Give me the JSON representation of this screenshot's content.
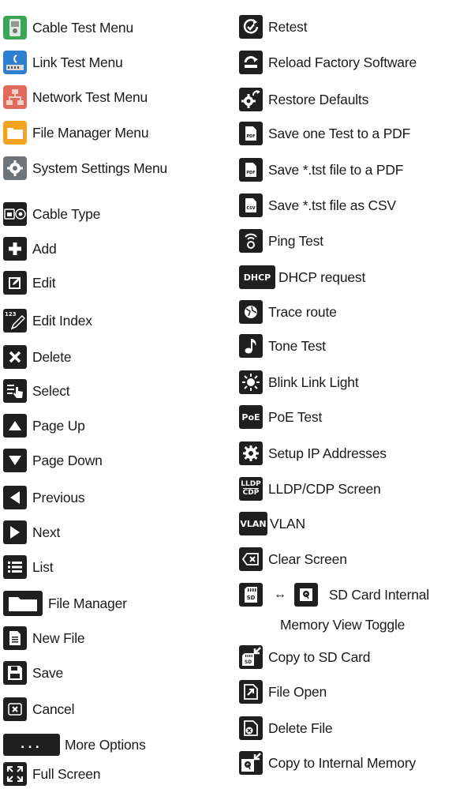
{
  "colors": {
    "icon_bg": "#1f1f1f",
    "cable_test": "#3aa655",
    "link_test": "#2f7fd0",
    "network_test": "#e26a5c",
    "file_manager": "#f5a31f",
    "system_settings": "#6f7478"
  },
  "left": [
    {
      "icon": "cable-test-menu-icon",
      "label": "Cable Test Menu"
    },
    {
      "icon": "link-test-menu-icon",
      "label": "Link Test Menu"
    },
    {
      "icon": "network-test-menu-icon",
      "label": "Network Test Menu"
    },
    {
      "icon": "file-manager-menu-icon",
      "label": "File Manager Menu"
    },
    {
      "icon": "system-settings-menu-icon",
      "label": "System Settings Menu"
    },
    {
      "icon": "cable-type-icon",
      "label": "Cable Type"
    },
    {
      "icon": "add-icon",
      "label": "Add"
    },
    {
      "icon": "edit-icon",
      "label": "Edit"
    },
    {
      "icon": "edit-index-icon",
      "label": "Edit Index",
      "icon_text": "123"
    },
    {
      "icon": "delete-icon",
      "label": "Delete"
    },
    {
      "icon": "select-icon",
      "label": "Select"
    },
    {
      "icon": "page-up-icon",
      "label": "Page Up"
    },
    {
      "icon": "page-down-icon",
      "label": "Page Down"
    },
    {
      "icon": "previous-icon",
      "label": "Previous"
    },
    {
      "icon": "next-icon",
      "label": "Next"
    },
    {
      "icon": "list-icon",
      "label": "List"
    },
    {
      "icon": "file-manager-icon",
      "label": "File Manager"
    },
    {
      "icon": "new-file-icon",
      "label": "New File"
    },
    {
      "icon": "save-icon",
      "label": "Save"
    },
    {
      "icon": "cancel-icon",
      "label": "Cancel"
    },
    {
      "icon": "more-options-icon",
      "label": "More Options",
      "icon_text": "..."
    },
    {
      "icon": "full-screen-icon",
      "label": "Full Screen"
    }
  ],
  "right": [
    {
      "icon": "retest-icon",
      "label": "Retest"
    },
    {
      "icon": "reload-factory-software-icon",
      "label": "Reload Factory Software"
    },
    {
      "icon": "restore-defaults-icon",
      "label": "Restore Defaults"
    },
    {
      "icon": "save-test-pdf-icon",
      "label": "Save one Test to a PDF",
      "icon_text": "PDF"
    },
    {
      "icon": "save-tst-pdf-icon",
      "label": "Save *.tst file to a PDF",
      "icon_text": "PDF"
    },
    {
      "icon": "save-tst-csv-icon",
      "label": "Save *.tst file as CSV",
      "icon_text": "CSV"
    },
    {
      "icon": "ping-test-icon",
      "label": "Ping Test"
    },
    {
      "icon": "dhcp-request-icon",
      "label": "DHCP request",
      "icon_text": "DHCP"
    },
    {
      "icon": "trace-route-icon",
      "label": "Trace route"
    },
    {
      "icon": "tone-test-icon",
      "label": "Tone Test"
    },
    {
      "icon": "blink-link-light-icon",
      "label": "Blink Link Light"
    },
    {
      "icon": "poe-test-icon",
      "label": "PoE Test",
      "icon_text": "PoE"
    },
    {
      "icon": "setup-ip-addresses-icon",
      "label": "Setup IP Addresses"
    },
    {
      "icon": "lldp-cdp-screen-icon",
      "label": "LLDP/CDP Screen",
      "icon_text": "LLDP",
      "icon_text2": "CDP"
    },
    {
      "icon": "vlan-icon",
      "label": "VLAN",
      "icon_text": "VLAN"
    },
    {
      "icon": "clear-screen-icon",
      "label": "Clear Screen"
    },
    {
      "icon": "sd-card-icon",
      "label": "SD Card Internal",
      "label2": "Memory View Toggle",
      "arrow": "↔",
      "icon_text": "SD"
    },
    {
      "icon": "copy-to-sd-card-icon",
      "label": "Copy to SD Card",
      "icon_text": "SD"
    },
    {
      "icon": "file-open-icon",
      "label": "File Open"
    },
    {
      "icon": "delete-file-icon",
      "label": "Delete File"
    },
    {
      "icon": "copy-to-internal-memory-icon",
      "label": "Copy to Internal Memory"
    }
  ]
}
